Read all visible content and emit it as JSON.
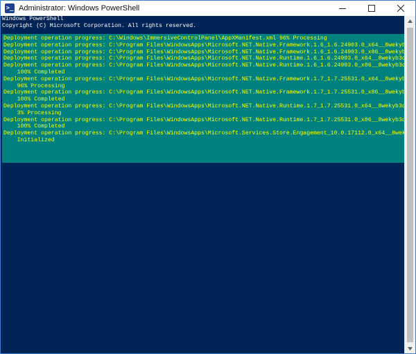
{
  "window": {
    "title": "Administrator: Windows PowerShell",
    "icon": "powershell-icon",
    "icon_glyph": ">_"
  },
  "controls": {
    "minimize_icon": "minimize-icon",
    "maximize_icon": "maximize-icon",
    "close_icon": "close-icon"
  },
  "console": {
    "banner": [
      "Windows PowerShell",
      "Copyright (C) Microsoft Corporation. All rights reserved."
    ],
    "progress_lines": [
      "Deployment operation progress: C:\\Windows\\ImmersiveControlPanel\\AppXManifest.xml 96% Processing",
      "Deployment operation progress: C:\\Program Files\\WindowsApps\\Microsoft.NET.Native.Framework.1.6_1.6.24903.0_x64__8wekyb3",
      "Deployment operation progress: C:\\Program Files\\WindowsApps\\Microsoft.NET.Native.Framework.1.6_1.6.24903.0_x86__8wekyb3",
      "Deployment operation progress: C:\\Program Files\\WindowsApps\\Microsoft.NET.Native.Runtime.1.6_1.6.24903.0_x64__8wekyb3d8",
      "Deployment operation progress: C:\\Program Files\\WindowsApps\\Microsoft.NET.Native.Runtime.1.6_1.6.24903.0_x86__8wekyb3d8",
      "    100% Completed",
      "Deployment operation progress: C:\\Program Files\\WindowsApps\\Microsoft.NET.Native.Framework.1.7_1.7.25531.0_x64__8wekyb3",
      "    96% Processing",
      "Deployment operation progress: C:\\Program Files\\WindowsApps\\Microsoft.NET.Native.Framework.1.7_1.7.25531.0_x86__8wekyb3",
      "    100% Completed",
      "Deployment operation progress: C:\\Program Files\\WindowsApps\\Microsoft.NET.Native.Runtime.1.7_1.7.25531.0_x64__8wekyb3d8",
      "    3% Processing",
      "Deployment operation progress: C:\\Program Files\\WindowsApps\\Microsoft.NET.Native.Runtime.1.7_1.7.25531.0_x86__8wekyb3d8",
      "    100% Completed",
      "Deployment operation progress: C:\\Program Files\\WindowsApps\\Microsoft.Services.Store.Engagement_10.0.17112.0_x64__8weky",
      "    Initialized"
    ],
    "colors": {
      "background": "#012456",
      "text": "#ffffff",
      "progress_background": "#00807f",
      "progress_text": "#ffff00"
    }
  }
}
